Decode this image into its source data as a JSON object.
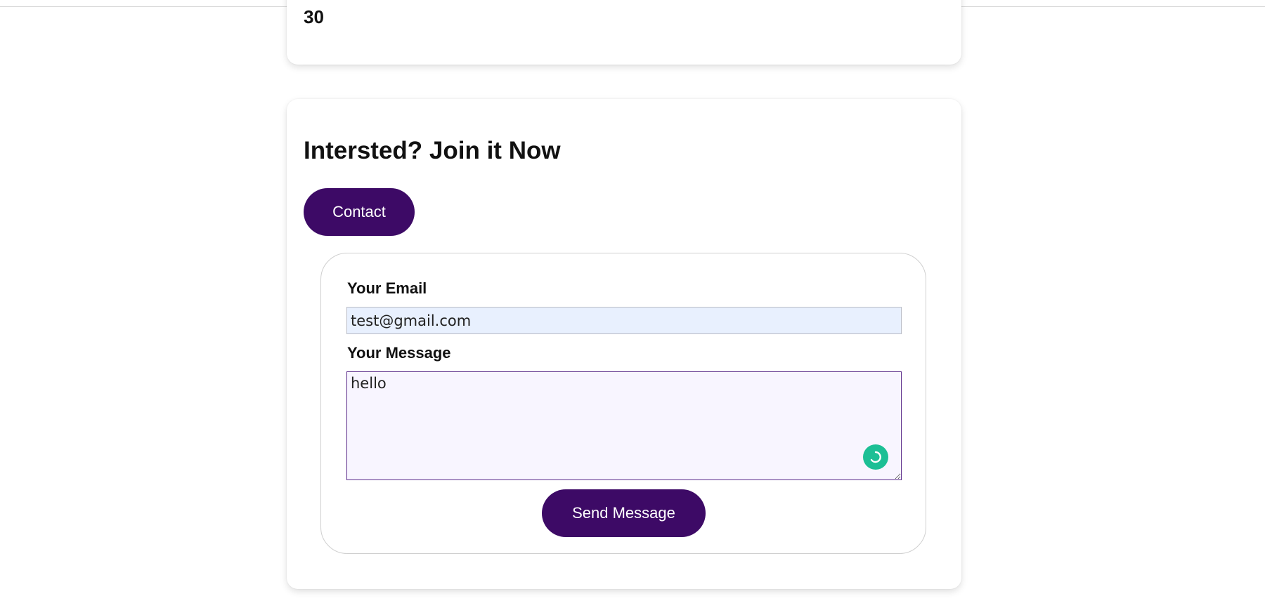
{
  "stats_card": {
    "value": "30"
  },
  "join_card": {
    "heading": "Intersted? Join it Now",
    "contact_label": "Contact"
  },
  "form": {
    "email_label": "Your Email",
    "email_value": "test@gmail.com",
    "message_label": "Your Message",
    "message_value": "hello",
    "send_label": "Send Message",
    "assistant_icon": "grammar-assistant-icon"
  },
  "colors": {
    "brand_purple": "#3d0a66",
    "autofill_blue": "#e8f0fe",
    "focus_border": "#5a2a8a",
    "assistant_green": "#1cbf95"
  }
}
